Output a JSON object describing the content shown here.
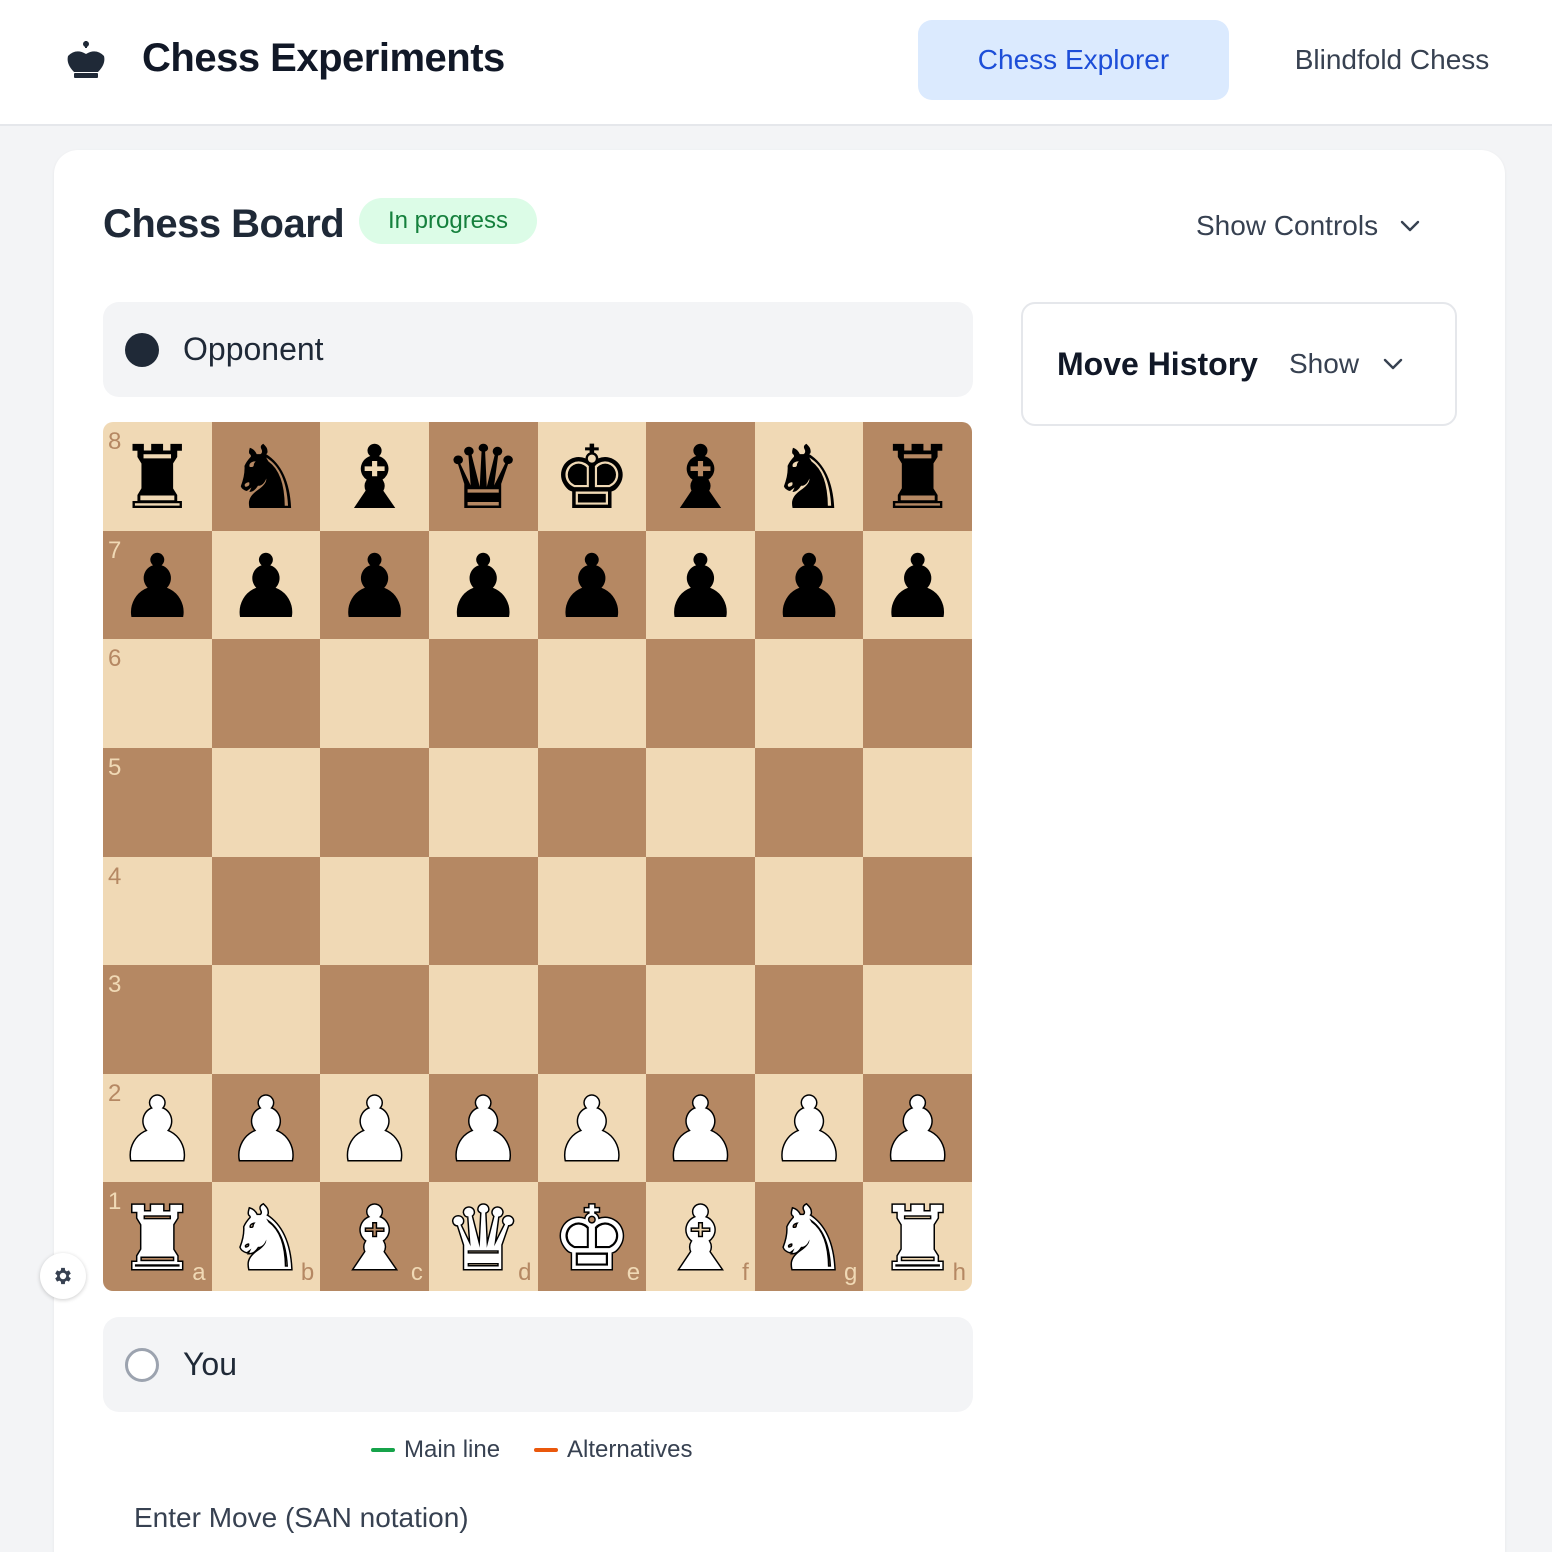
{
  "app": {
    "title": "Chess Experiments",
    "logo_icon": "crown-icon"
  },
  "nav": {
    "tabs": [
      {
        "label": "Chess Explorer",
        "active": true
      },
      {
        "label": "Blindfold Chess",
        "active": false
      }
    ]
  },
  "board_header": {
    "title": "Chess Board",
    "status": "In progress",
    "controls_toggle": "Show Controls"
  },
  "players": {
    "top": {
      "name": "Opponent",
      "color": "black"
    },
    "bottom": {
      "name": "You",
      "color": "white"
    }
  },
  "board": {
    "files": [
      "a",
      "b",
      "c",
      "d",
      "e",
      "f",
      "g",
      "h"
    ],
    "ranks": [
      "8",
      "7",
      "6",
      "5",
      "4",
      "3",
      "2",
      "1"
    ],
    "position": [
      [
        "br",
        "bn",
        "bb",
        "bq",
        "bk",
        "bb",
        "bn",
        "br"
      ],
      [
        "bp",
        "bp",
        "bp",
        "bp",
        "bp",
        "bp",
        "bp",
        "bp"
      ],
      [
        "",
        "",
        "",
        "",
        "",
        "",
        "",
        ""
      ],
      [
        "",
        "",
        "",
        "",
        "",
        "",
        "",
        ""
      ],
      [
        "",
        "",
        "",
        "",
        "",
        "",
        "",
        ""
      ],
      [
        "",
        "",
        "",
        "",
        "",
        "",
        "",
        ""
      ],
      [
        "wp",
        "wp",
        "wp",
        "wp",
        "wp",
        "wp",
        "wp",
        "wp"
      ],
      [
        "wr",
        "wn",
        "wb",
        "wq",
        "wk",
        "wb",
        "wn",
        "wr"
      ]
    ],
    "light_color": "#f0d9b5",
    "dark_color": "#b58863"
  },
  "move_history": {
    "title": "Move History",
    "toggle": "Show"
  },
  "legend": {
    "main_line": {
      "label": "Main line",
      "color": "#16a34a"
    },
    "alternatives": {
      "label": "Alternatives",
      "color": "#ea580c"
    }
  },
  "move_input": {
    "label": "Enter Move (SAN notation)"
  }
}
